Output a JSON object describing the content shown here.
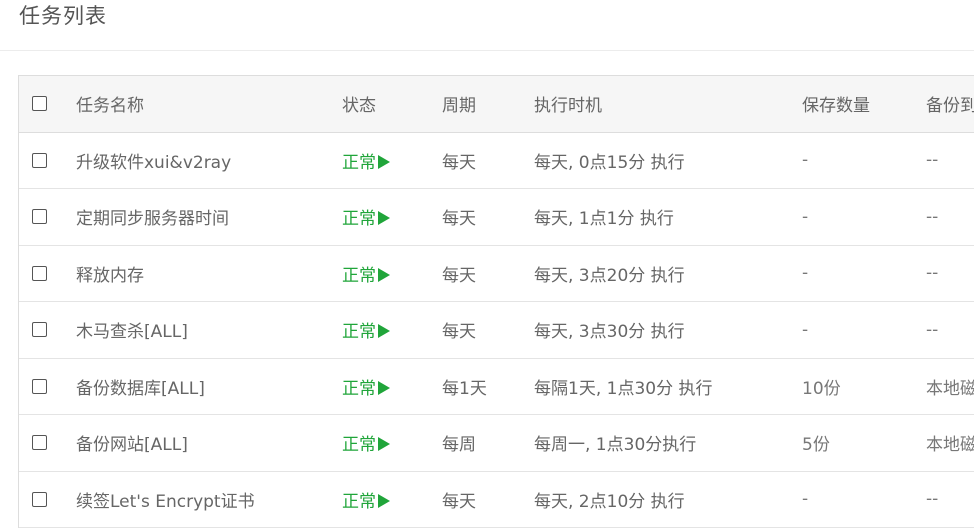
{
  "page": {
    "title": "任务列表"
  },
  "table": {
    "headers": {
      "name": "任务名称",
      "status": "状态",
      "period": "周期",
      "time": "执行时机",
      "keep": "保存数量",
      "backup": "备份到"
    },
    "rows": [
      {
        "name": "升级软件xui&v2ray",
        "status": "正常",
        "period": "每天",
        "time": "每天, 0点15分 执行",
        "keep": "-",
        "backup": "--"
      },
      {
        "name": "定期同步服务器时间",
        "status": "正常",
        "period": "每天",
        "time": "每天, 1点1分 执行",
        "keep": "-",
        "backup": "--"
      },
      {
        "name": "释放内存",
        "status": "正常",
        "period": "每天",
        "time": "每天, 3点20分 执行",
        "keep": "-",
        "backup": "--"
      },
      {
        "name": "木马查杀[ALL]",
        "status": "正常",
        "period": "每天",
        "time": "每天, 3点30分 执行",
        "keep": "-",
        "backup": "--"
      },
      {
        "name": "备份数据库[ALL]",
        "status": "正常",
        "period": "每1天",
        "time": "每隔1天, 1点30分 执行",
        "keep": "10份",
        "backup": "本地磁盘"
      },
      {
        "name": "备份网站[ALL]",
        "status": "正常",
        "period": "每周",
        "time": "每周一, 1点30分执行",
        "keep": "5份",
        "backup": "本地磁盘"
      },
      {
        "name": "续签Let's Encrypt证书",
        "status": "正常",
        "period": "每天",
        "time": "每天, 2点10分 执行",
        "keep": "-",
        "backup": "--"
      }
    ]
  },
  "colors": {
    "status_green": "#20a53a",
    "header_bg": "#f6f6f6",
    "border": "#dddddd"
  },
  "icons": {
    "status_icon": "play-icon",
    "checkbox_icon": "checkbox-icon"
  }
}
